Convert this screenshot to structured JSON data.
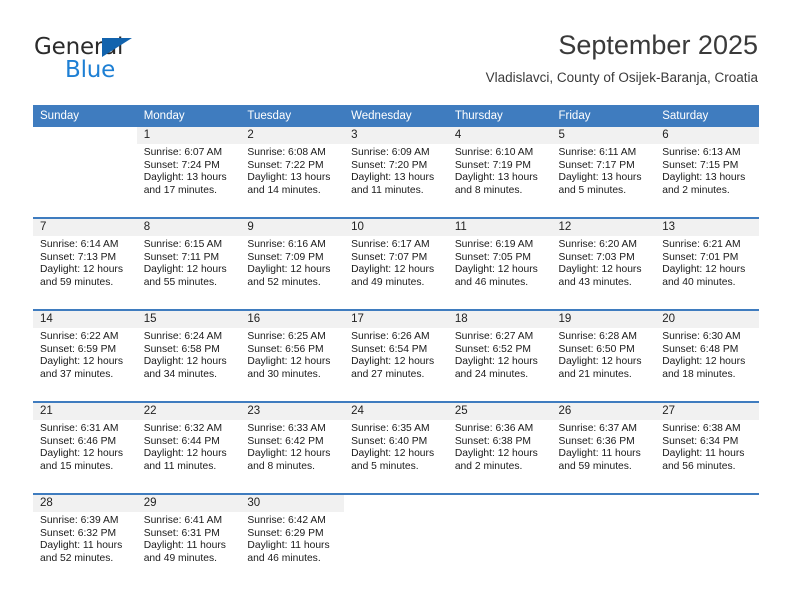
{
  "brand": {
    "name_part1": "General",
    "name_part2": "Blue",
    "accent_color": "#1d7fd4",
    "triangle_color": "#1263ad"
  },
  "header": {
    "title": "September 2025",
    "subtitle": "Vladislavci, County of Osijek-Baranja, Croatia"
  },
  "calendar": {
    "header_bg": "#3f7cbf",
    "daynum_band_bg": "#f1f1f1",
    "weekday_headers": [
      "Sunday",
      "Monday",
      "Tuesday",
      "Wednesday",
      "Thursday",
      "Friday",
      "Saturday"
    ],
    "weeks": [
      [
        {
          "day": "",
          "lines": []
        },
        {
          "day": "1",
          "lines": [
            "Sunrise: 6:07 AM",
            "Sunset: 7:24 PM",
            "Daylight: 13 hours",
            "and 17 minutes."
          ]
        },
        {
          "day": "2",
          "lines": [
            "Sunrise: 6:08 AM",
            "Sunset: 7:22 PM",
            "Daylight: 13 hours",
            "and 14 minutes."
          ]
        },
        {
          "day": "3",
          "lines": [
            "Sunrise: 6:09 AM",
            "Sunset: 7:20 PM",
            "Daylight: 13 hours",
            "and 11 minutes."
          ]
        },
        {
          "day": "4",
          "lines": [
            "Sunrise: 6:10 AM",
            "Sunset: 7:19 PM",
            "Daylight: 13 hours",
            "and 8 minutes."
          ]
        },
        {
          "day": "5",
          "lines": [
            "Sunrise: 6:11 AM",
            "Sunset: 7:17 PM",
            "Daylight: 13 hours",
            "and 5 minutes."
          ]
        },
        {
          "day": "6",
          "lines": [
            "Sunrise: 6:13 AM",
            "Sunset: 7:15 PM",
            "Daylight: 13 hours",
            "and 2 minutes."
          ]
        }
      ],
      [
        {
          "day": "7",
          "lines": [
            "Sunrise: 6:14 AM",
            "Sunset: 7:13 PM",
            "Daylight: 12 hours",
            "and 59 minutes."
          ]
        },
        {
          "day": "8",
          "lines": [
            "Sunrise: 6:15 AM",
            "Sunset: 7:11 PM",
            "Daylight: 12 hours",
            "and 55 minutes."
          ]
        },
        {
          "day": "9",
          "lines": [
            "Sunrise: 6:16 AM",
            "Sunset: 7:09 PM",
            "Daylight: 12 hours",
            "and 52 minutes."
          ]
        },
        {
          "day": "10",
          "lines": [
            "Sunrise: 6:17 AM",
            "Sunset: 7:07 PM",
            "Daylight: 12 hours",
            "and 49 minutes."
          ]
        },
        {
          "day": "11",
          "lines": [
            "Sunrise: 6:19 AM",
            "Sunset: 7:05 PM",
            "Daylight: 12 hours",
            "and 46 minutes."
          ]
        },
        {
          "day": "12",
          "lines": [
            "Sunrise: 6:20 AM",
            "Sunset: 7:03 PM",
            "Daylight: 12 hours",
            "and 43 minutes."
          ]
        },
        {
          "day": "13",
          "lines": [
            "Sunrise: 6:21 AM",
            "Sunset: 7:01 PM",
            "Daylight: 12 hours",
            "and 40 minutes."
          ]
        }
      ],
      [
        {
          "day": "14",
          "lines": [
            "Sunrise: 6:22 AM",
            "Sunset: 6:59 PM",
            "Daylight: 12 hours",
            "and 37 minutes."
          ]
        },
        {
          "day": "15",
          "lines": [
            "Sunrise: 6:24 AM",
            "Sunset: 6:58 PM",
            "Daylight: 12 hours",
            "and 34 minutes."
          ]
        },
        {
          "day": "16",
          "lines": [
            "Sunrise: 6:25 AM",
            "Sunset: 6:56 PM",
            "Daylight: 12 hours",
            "and 30 minutes."
          ]
        },
        {
          "day": "17",
          "lines": [
            "Sunrise: 6:26 AM",
            "Sunset: 6:54 PM",
            "Daylight: 12 hours",
            "and 27 minutes."
          ]
        },
        {
          "day": "18",
          "lines": [
            "Sunrise: 6:27 AM",
            "Sunset: 6:52 PM",
            "Daylight: 12 hours",
            "and 24 minutes."
          ]
        },
        {
          "day": "19",
          "lines": [
            "Sunrise: 6:28 AM",
            "Sunset: 6:50 PM",
            "Daylight: 12 hours",
            "and 21 minutes."
          ]
        },
        {
          "day": "20",
          "lines": [
            "Sunrise: 6:30 AM",
            "Sunset: 6:48 PM",
            "Daylight: 12 hours",
            "and 18 minutes."
          ]
        }
      ],
      [
        {
          "day": "21",
          "lines": [
            "Sunrise: 6:31 AM",
            "Sunset: 6:46 PM",
            "Daylight: 12 hours",
            "and 15 minutes."
          ]
        },
        {
          "day": "22",
          "lines": [
            "Sunrise: 6:32 AM",
            "Sunset: 6:44 PM",
            "Daylight: 12 hours",
            "and 11 minutes."
          ]
        },
        {
          "day": "23",
          "lines": [
            "Sunrise: 6:33 AM",
            "Sunset: 6:42 PM",
            "Daylight: 12 hours",
            "and 8 minutes."
          ]
        },
        {
          "day": "24",
          "lines": [
            "Sunrise: 6:35 AM",
            "Sunset: 6:40 PM",
            "Daylight: 12 hours",
            "and 5 minutes."
          ]
        },
        {
          "day": "25",
          "lines": [
            "Sunrise: 6:36 AM",
            "Sunset: 6:38 PM",
            "Daylight: 12 hours",
            "and 2 minutes."
          ]
        },
        {
          "day": "26",
          "lines": [
            "Sunrise: 6:37 AM",
            "Sunset: 6:36 PM",
            "Daylight: 11 hours",
            "and 59 minutes."
          ]
        },
        {
          "day": "27",
          "lines": [
            "Sunrise: 6:38 AM",
            "Sunset: 6:34 PM",
            "Daylight: 11 hours",
            "and 56 minutes."
          ]
        }
      ],
      [
        {
          "day": "28",
          "lines": [
            "Sunrise: 6:39 AM",
            "Sunset: 6:32 PM",
            "Daylight: 11 hours",
            "and 52 minutes."
          ]
        },
        {
          "day": "29",
          "lines": [
            "Sunrise: 6:41 AM",
            "Sunset: 6:31 PM",
            "Daylight: 11 hours",
            "and 49 minutes."
          ]
        },
        {
          "day": "30",
          "lines": [
            "Sunrise: 6:42 AM",
            "Sunset: 6:29 PM",
            "Daylight: 11 hours",
            "and 46 minutes."
          ]
        },
        {
          "day": "",
          "lines": []
        },
        {
          "day": "",
          "lines": []
        },
        {
          "day": "",
          "lines": []
        },
        {
          "day": "",
          "lines": []
        }
      ]
    ]
  }
}
